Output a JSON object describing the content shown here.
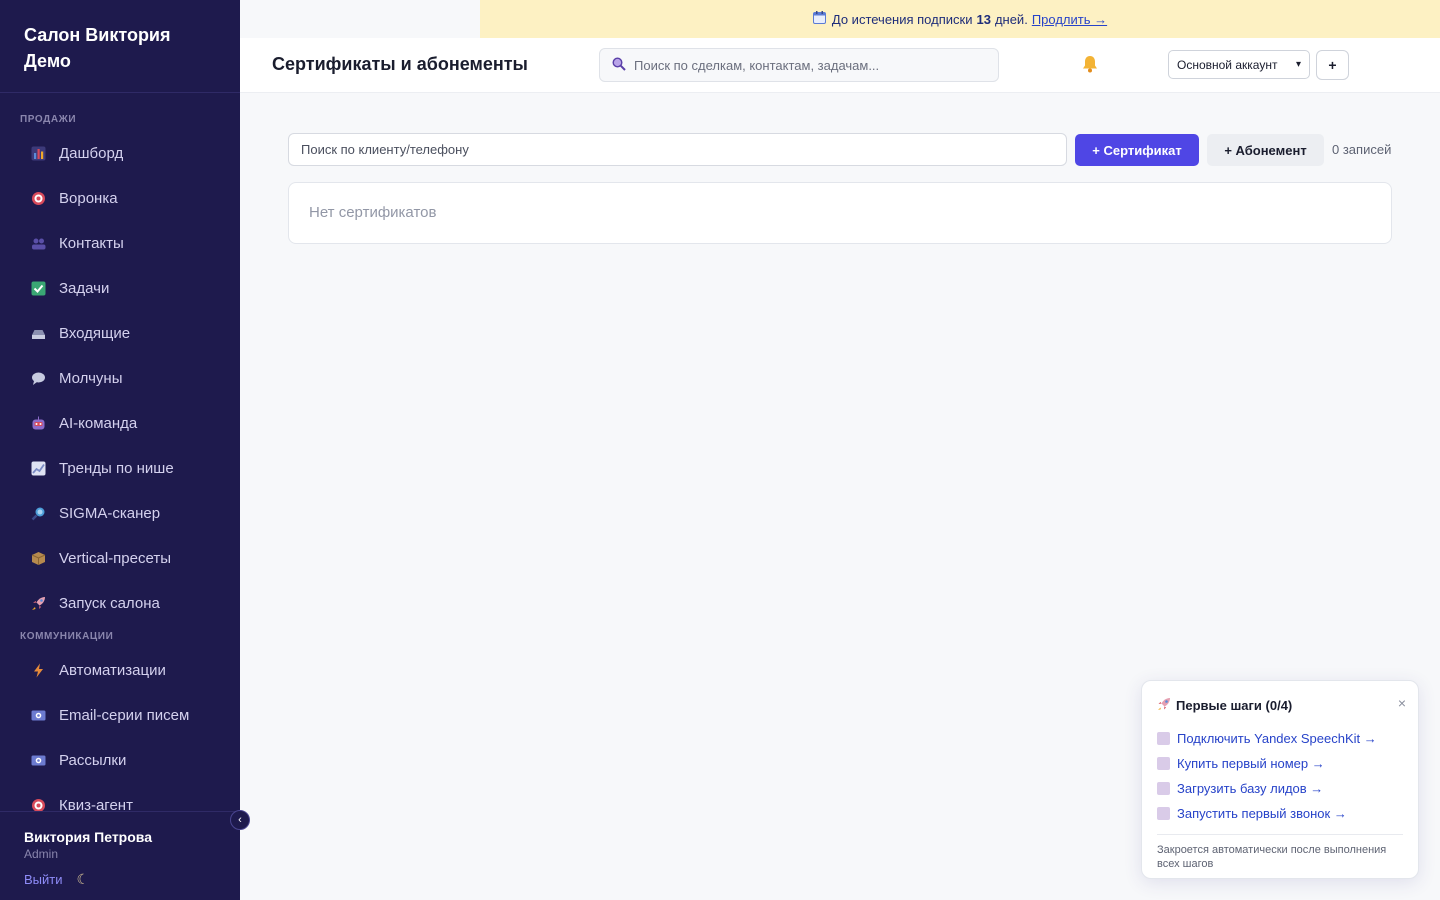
{
  "sidebar": {
    "brand": "Салон Виктория Демо",
    "sections": [
      {
        "label": "ПРОДАЖИ",
        "items": [
          {
            "label": "Дашборд",
            "icon": "bar-chart-icon",
            "color": "#5b8bd8"
          },
          {
            "label": "Воронка",
            "icon": "target-icon",
            "color": "#d84a5b"
          },
          {
            "label": "Контакты",
            "icon": "people-icon",
            "color": "#5a4fa8"
          },
          {
            "label": "Задачи",
            "icon": "checkmark-icon",
            "color": "#3aa774"
          },
          {
            "label": "Входящие",
            "icon": "inbox-icon",
            "color": "#8a8fb0"
          },
          {
            "label": "Молчуны",
            "icon": "speech-bubble-icon",
            "color": "#c7cbe0"
          },
          {
            "label": "AI-команда",
            "icon": "robot-icon",
            "color": "#8c6bc9"
          },
          {
            "label": "Тренды по нише",
            "icon": "trend-chart-icon",
            "color": "#7a8bc4"
          },
          {
            "label": "SIGMA-сканер",
            "icon": "magnifier-icon",
            "color": "#4c9ed9"
          },
          {
            "label": "Vertical-пресеты",
            "icon": "package-icon",
            "color": "#b68a4e"
          },
          {
            "label": "Запуск салона",
            "icon": "rocket-icon",
            "color": "#d96a7a"
          }
        ]
      },
      {
        "label": "КОММУНИКАЦИИ",
        "items": [
          {
            "label": "Автоматизации",
            "icon": "lightning-icon",
            "color": "#e58a3a"
          },
          {
            "label": "Email-серии писем",
            "icon": "email-icon",
            "color": "#6c7bd0"
          },
          {
            "label": "Рассылки",
            "icon": "broadcast-icon",
            "color": "#6c7bd0"
          },
          {
            "label": "Квиз-агент",
            "icon": "target-icon",
            "color": "#d84a5b"
          }
        ]
      }
    ],
    "user": {
      "name": "Виктория Петрова",
      "role": "Admin"
    },
    "logout_label": "Выйти",
    "collapse_symbol": "‹"
  },
  "banner": {
    "prefix": "До истечения подписки",
    "days": "13",
    "suffix": "дней.",
    "link": "Продлить →"
  },
  "header": {
    "title": "Сертификаты и абонементы",
    "search_placeholder": "Поиск по сделкам, контактам, задачам...",
    "account": "Основной аккаунт",
    "add_label": "+"
  },
  "main": {
    "client_search_placeholder": "Поиск по клиенту/телефону",
    "add_certificate": "+ Сертификат",
    "add_subscription": "+ Абонемент",
    "records_count": "0 записей",
    "empty_text": "Нет сертификатов"
  },
  "onboarding": {
    "title": "Первые шаги (0/4)",
    "close": "×",
    "steps": [
      "Подключить Yandex SpeechKit →",
      "Купить первый номер →",
      "Загрузить базу лидов →",
      "Запустить первый звонок →"
    ],
    "note": "Закроется автоматически после выполнения всех шагов"
  },
  "colors": {
    "sidebar_bg": "#1e1a4d",
    "accent": "#4f46e5",
    "banner_bg": "#fdf1c3",
    "link": "#2743c9"
  }
}
